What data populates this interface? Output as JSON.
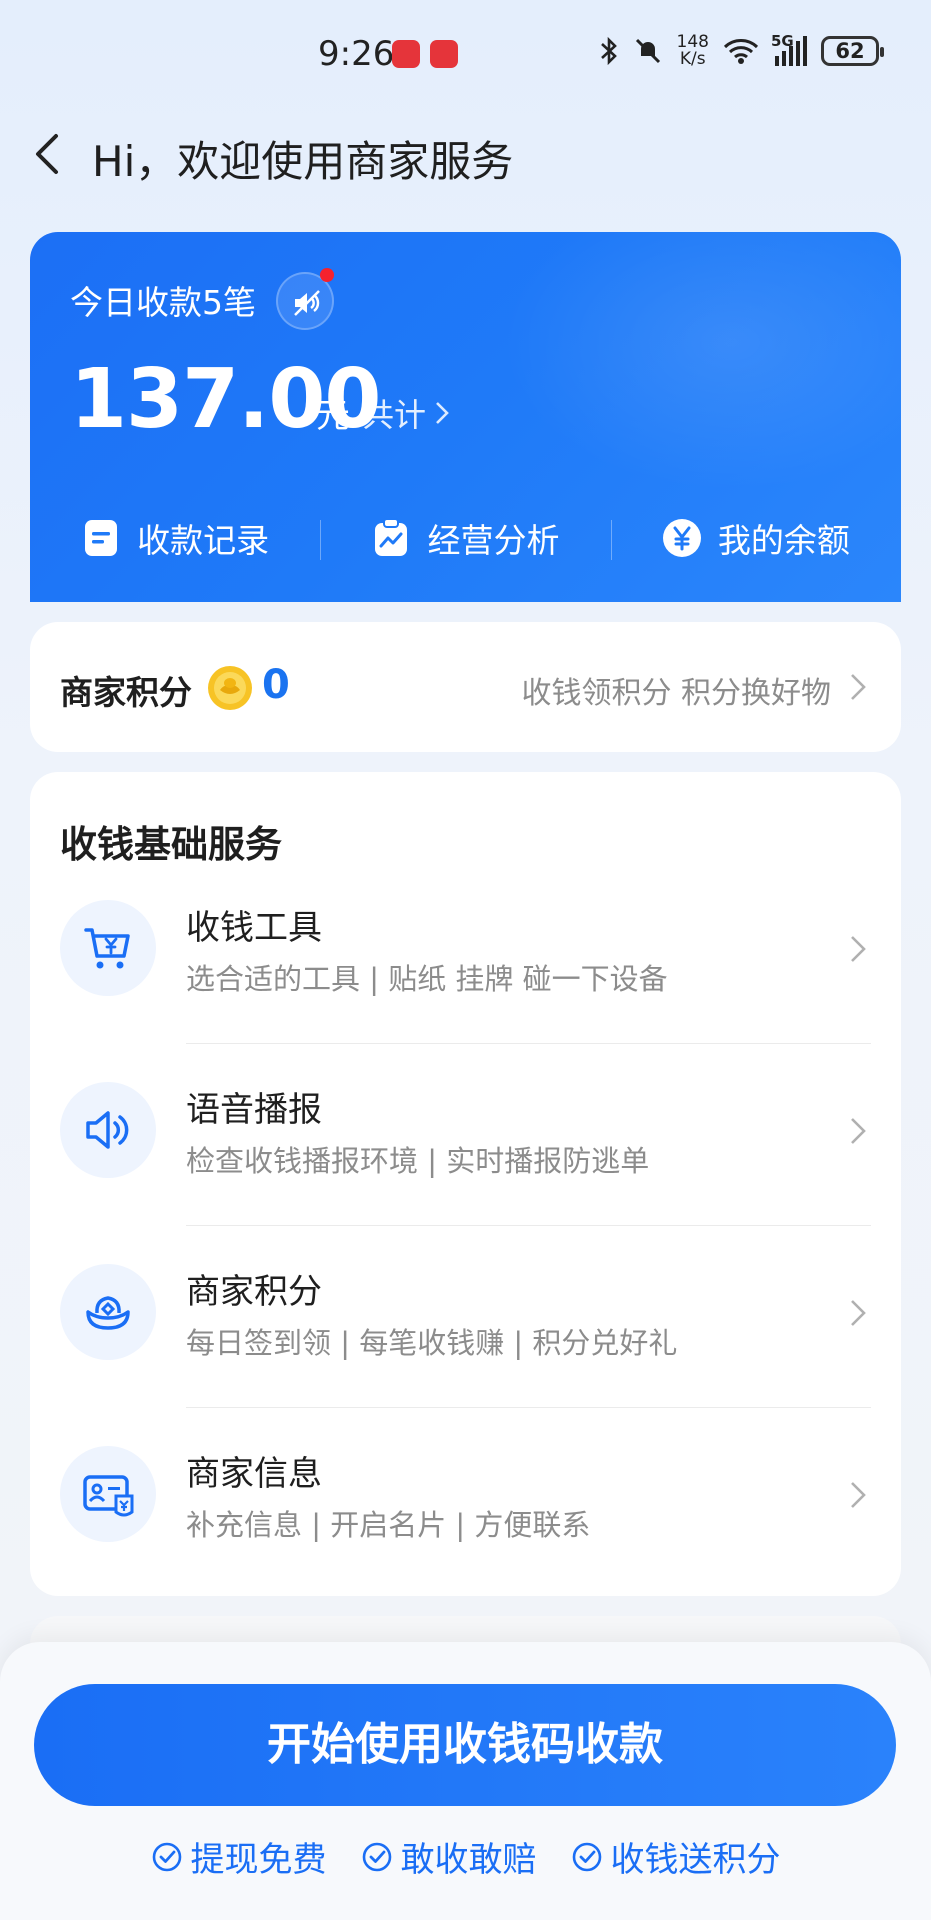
{
  "status_bar": {
    "time": "9:26",
    "net_speed_value": "148",
    "net_speed_unit": "K/s",
    "network": "5G",
    "battery": "62"
  },
  "header": {
    "title": "Hi，欢迎使用商家服务"
  },
  "income": {
    "today_label": "今日收款5笔",
    "amount": "137.00",
    "unit": "元",
    "total_label": "共计",
    "actions": [
      {
        "label": "收款记录",
        "icon": "document-icon"
      },
      {
        "label": "经营分析",
        "icon": "chart-clipboard-icon"
      },
      {
        "label": "我的余额",
        "icon": "yen-circle-icon"
      }
    ]
  },
  "points": {
    "title": "商家积分",
    "value": "0",
    "hint": "收钱领积分 积分换好物"
  },
  "services": {
    "title": "收钱基础服务",
    "items": [
      {
        "title": "收钱工具",
        "desc": "选合适的工具 | 贴纸 挂牌 碰一下设备",
        "icon": "cart-yen-icon"
      },
      {
        "title": "语音播报",
        "desc": "检查收钱播报环境 | 实时播报防逃单",
        "icon": "speaker-icon"
      },
      {
        "title": "商家积分",
        "desc": "每日签到领 | 每笔收钱赚 | 积分兑好礼",
        "icon": "points-ingot-icon"
      },
      {
        "title": "商家信息",
        "desc": "补充信息 | 开启名片 | 方便联系",
        "icon": "id-card-icon"
      }
    ]
  },
  "bottom": {
    "primary_button": "开始使用收钱码收款",
    "badges": [
      "提现免费",
      "敢收敢赔",
      "收钱送积分"
    ]
  },
  "colors": {
    "primary": "#1a6ef5",
    "card_blue": "#1f7af8",
    "accent_red": "#f5222d"
  }
}
